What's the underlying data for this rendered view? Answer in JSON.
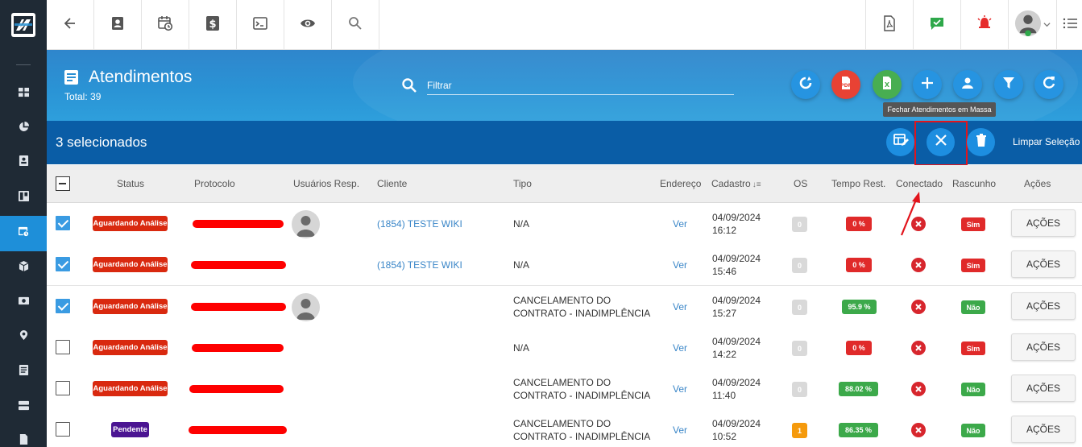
{
  "sidebar": {
    "items": [
      {
        "name": "sidebar-item-dashboard",
        "icon": "grid-icon"
      },
      {
        "name": "sidebar-item-reports",
        "icon": "pie-chart-icon"
      },
      {
        "name": "sidebar-item-contacts",
        "icon": "contact-card-icon"
      },
      {
        "name": "sidebar-item-board",
        "icon": "board-icon"
      },
      {
        "name": "sidebar-item-atendimentos",
        "icon": "calendar-clock-icon",
        "active": true
      },
      {
        "name": "sidebar-item-products",
        "icon": "box-icon"
      },
      {
        "name": "sidebar-item-finance",
        "icon": "money-icon"
      },
      {
        "name": "sidebar-item-map",
        "icon": "map-pin-icon"
      },
      {
        "name": "sidebar-item-documents",
        "icon": "document-icon"
      },
      {
        "name": "sidebar-item-servers",
        "icon": "server-icon"
      },
      {
        "name": "sidebar-item-files",
        "icon": "file-icon"
      }
    ]
  },
  "header": {
    "title": "Atendimentos",
    "total": "Total: 39",
    "filter_placeholder": "Filtrar"
  },
  "tooltip": "Fechar Atendimentos em Massa",
  "selection_bar": {
    "count_label": "3 selecionados",
    "clear_label": "Limpar Seleção"
  },
  "table": {
    "columns": {
      "status": "Status",
      "protocolo": "Protocolo",
      "usuarios": "Usuários Resp.",
      "cliente": "Cliente",
      "tipo": "Tipo",
      "endereco": "Endereço",
      "cadastro": "Cadastro",
      "os": "OS",
      "tempo": "Tempo Rest.",
      "conectado": "Conectado",
      "rascunho": "Rascunho",
      "acoes": "Ações"
    },
    "rows": [
      {
        "checked": true,
        "status": "Aguardando Análise",
        "status_color": "red",
        "avatar": true,
        "cliente": "(1854) TESTE WIKI",
        "tipo1": "N/A",
        "tipo2": "",
        "endereco": "Ver",
        "date": "04/09/2024",
        "time": "16:12",
        "os": "0",
        "tempo": "0 %",
        "tempo_color": "red",
        "rascunho": "Sim",
        "acoes": "AÇÕES"
      },
      {
        "checked": true,
        "status": "Aguardando Análise",
        "status_color": "red",
        "avatar": false,
        "cliente": "(1854) TESTE WIKI",
        "tipo1": "N/A",
        "tipo2": "",
        "endereco": "Ver",
        "date": "04/09/2024",
        "time": "15:46",
        "os": "0",
        "tempo": "0 %",
        "tempo_color": "red",
        "rascunho": "Sim",
        "acoes": "AÇÕES"
      },
      {
        "checked": true,
        "status": "Aguardando Análise",
        "status_color": "red",
        "avatar": true,
        "cliente": "",
        "tipo1": "CANCELAMENTO DO",
        "tipo2": "CONTRATO - INADIMPLÊNCIA",
        "endereco": "Ver",
        "date": "04/09/2024",
        "time": "15:27",
        "os": "0",
        "tempo": "95.9 %",
        "tempo_color": "green",
        "rascunho": "Não",
        "acoes": "AÇÕES"
      },
      {
        "checked": false,
        "status": "Aguardando Análise",
        "status_color": "red",
        "avatar": false,
        "cliente": "",
        "tipo1": "N/A",
        "tipo2": "",
        "endereco": "Ver",
        "date": "04/09/2024",
        "time": "14:22",
        "os": "0",
        "tempo": "0 %",
        "tempo_color": "red",
        "rascunho": "Sim",
        "acoes": "AÇÕES"
      },
      {
        "checked": false,
        "status": "Aguardando Análise",
        "status_color": "red",
        "avatar": false,
        "cliente": "",
        "tipo1": "CANCELAMENTO DO",
        "tipo2": "CONTRATO - INADIMPLÊNCIA",
        "endereco": "Ver",
        "date": "04/09/2024",
        "time": "11:40",
        "os": "0",
        "tempo": "88.02 %",
        "tempo_color": "green",
        "rascunho": "Não",
        "acoes": "AÇÕES"
      },
      {
        "checked": false,
        "status": "Pendente",
        "status_color": "purple",
        "avatar": false,
        "cliente": "",
        "tipo1": "CANCELAMENTO DO",
        "tipo2": "CONTRATO - INADIMPLÊNCIA",
        "endereco": "Ver",
        "date": "04/09/2024",
        "time": "10:52",
        "os": "1",
        "tempo": "86.35 %",
        "tempo_color": "green",
        "rascunho": "Não",
        "acoes": "AÇÕES"
      }
    ]
  },
  "colors": {
    "sidebar_bg": "#1f2a35",
    "active_blue": "#1e8fd9",
    "selection_bar": "#0a5da6",
    "status_red": "#d9290f",
    "status_purple": "#4b1592",
    "success_green": "#3ca94a",
    "danger_red": "#e02a2a"
  }
}
